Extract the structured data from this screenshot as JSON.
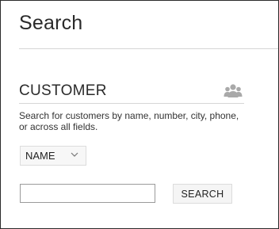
{
  "page": {
    "title": "Search"
  },
  "section": {
    "title": "CUSTOMER",
    "icon": "customers-group-icon",
    "description": "Search for customers by name, number, city, phone, or across all fields."
  },
  "search": {
    "field_selected": "NAME",
    "query_value": "",
    "button_label": "SEARCH"
  },
  "colors": {
    "text": "#2a2a2a",
    "icon": "#a9a9a9",
    "divider": "#d6d6d6",
    "border": "#2b2b2b"
  }
}
